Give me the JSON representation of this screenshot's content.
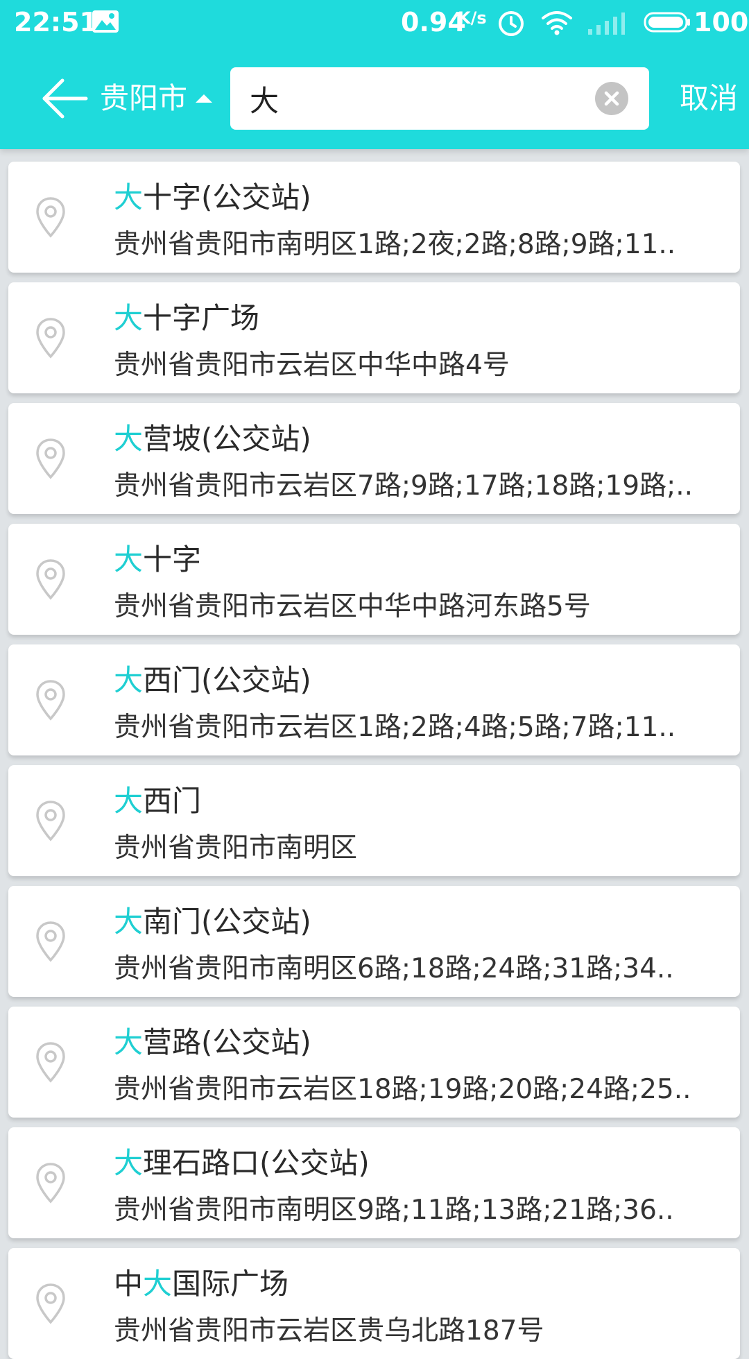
{
  "status_bar": {
    "time": "22:51",
    "net_speed": "0.94",
    "net_speed_unit": "K/s",
    "battery": "100"
  },
  "header": {
    "city": "贵阳市",
    "cancel_label": "取消"
  },
  "search": {
    "value": "大"
  },
  "colors": {
    "accent": "#1fdbdc",
    "highlight": "#1fcfd2"
  },
  "results": [
    {
      "title_pre": "",
      "title_hl": "大",
      "title_post": "十字(公交站)",
      "address": "贵州省贵阳市南明区1路;2夜;2路;8路;9路;11.."
    },
    {
      "title_pre": "",
      "title_hl": "大",
      "title_post": "十字广场",
      "address": "贵州省贵阳市云岩区中华中路4号"
    },
    {
      "title_pre": "",
      "title_hl": "大",
      "title_post": "营坡(公交站)",
      "address": "贵州省贵阳市云岩区7路;9路;17路;18路;19路;.."
    },
    {
      "title_pre": "",
      "title_hl": "大",
      "title_post": "十字",
      "address": "贵州省贵阳市云岩区中华中路河东路5号"
    },
    {
      "title_pre": "",
      "title_hl": "大",
      "title_post": "西门(公交站)",
      "address": "贵州省贵阳市云岩区1路;2路;4路;5路;7路;11.."
    },
    {
      "title_pre": "",
      "title_hl": "大",
      "title_post": "西门",
      "address": "贵州省贵阳市南明区"
    },
    {
      "title_pre": "",
      "title_hl": "大",
      "title_post": "南门(公交站)",
      "address": "贵州省贵阳市南明区6路;18路;24路;31路;34.."
    },
    {
      "title_pre": "",
      "title_hl": "大",
      "title_post": "营路(公交站)",
      "address": "贵州省贵阳市云岩区18路;19路;20路;24路;25.."
    },
    {
      "title_pre": "",
      "title_hl": "大",
      "title_post": "理石路口(公交站)",
      "address": "贵州省贵阳市南明区9路;11路;13路;21路;36.."
    },
    {
      "title_pre": "中",
      "title_hl": "大",
      "title_post": "国际广场",
      "address": "贵州省贵阳市云岩区贵乌北路187号"
    }
  ]
}
